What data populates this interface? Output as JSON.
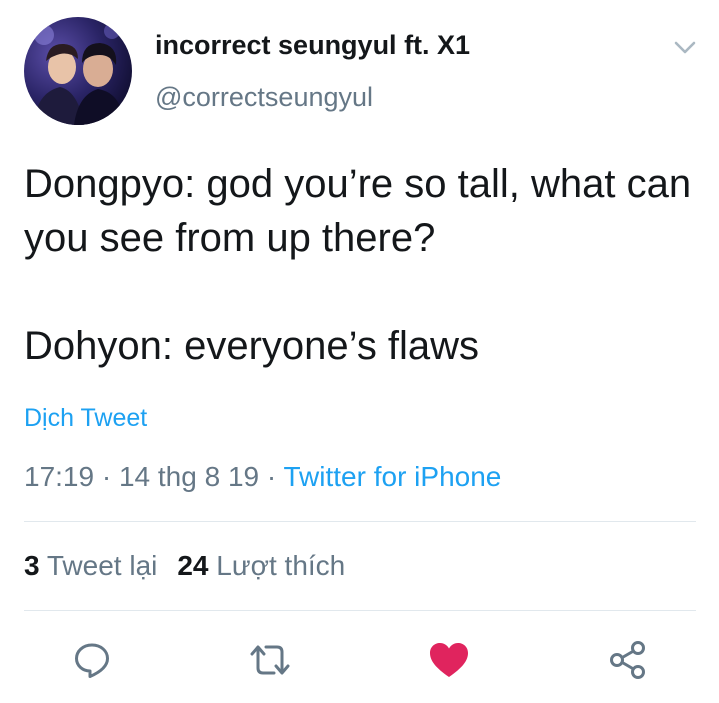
{
  "user": {
    "display_name": "incorrect seungyul ft. X1",
    "handle": "@correctseungyul",
    "avatar_icon": "profile-photo"
  },
  "tweet": {
    "lines": [
      "Dongpyo: god you’re so tall, what can you see from up there?",
      "Dohyon: everyone’s flaws"
    ],
    "translate_label": "Dịch Tweet",
    "time": "17:19",
    "date": "14 thg 8 19",
    "separator": " · ",
    "source": "Twitter for iPhone"
  },
  "stats": {
    "retweets_count": "3",
    "retweets_label": "Tweet lại",
    "likes_count": "24",
    "likes_label": "Lượt thích"
  },
  "actions": {
    "reply_icon": "reply-icon",
    "retweet_icon": "retweet-icon",
    "like_icon": "heart-icon",
    "share_icon": "share-icon"
  },
  "colors": {
    "accent": "#1da1f2",
    "text": "#14171a",
    "muted": "#657786",
    "icon": "#657786",
    "like": "#e0245e",
    "divider": "#e1e8ed"
  }
}
